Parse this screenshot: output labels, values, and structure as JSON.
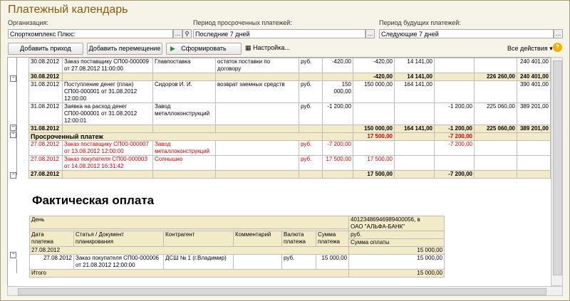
{
  "window": {
    "title": "Платежный календарь"
  },
  "filters": {
    "org_label": "Организация:",
    "org_value": "Спорткомплекс Плюс:",
    "overdue_label": "Период просроченных платежей:",
    "overdue_value": "Последние 7 дней",
    "future_label": "Период будущих платежей:",
    "future_value": "Следующие 7 дней"
  },
  "toolbar": {
    "add_income": "Добавить приход",
    "add_move": "Добавить перемещение",
    "generate": "Сформировать",
    "settings": "Настройка...",
    "all_actions": "Все действия ▾",
    "help": "?"
  },
  "plan_table": {
    "rows": [
      {
        "date": "30.08.2012",
        "doc": "Заказ поставщику СП00-000009\nот 27.08.2012 11:00:00",
        "counterparty": "Главпоставка",
        "comment": "остаток поставки по\nдоговору",
        "cur": "руб.",
        "sum": "-420,00",
        "c1": "-420,00",
        "c2": "14 141,00",
        "c3": "",
        "c4": "",
        "c5": "240 401,00",
        "type": "row"
      },
      {
        "date": "30.08.2012",
        "doc": "",
        "counterparty": "",
        "comment": "",
        "cur": "",
        "sum": "",
        "c1": "-420,00",
        "c2": "14 141,00",
        "c3": "",
        "c4": "226 260,00",
        "c5": "240 401,00",
        "type": "sum"
      },
      {
        "date": "31.08.2012",
        "doc": "Поступление денег (план)\nСП00-000001 от 31.08.2012\n12:00:00",
        "counterparty": "Сидоров И. И.",
        "comment": "возврат заемных средств",
        "cur": "руб.",
        "sum": "150 000,00",
        "c1": "150 000,00",
        "c2": "164 141,00",
        "c3": "",
        "c4": "",
        "c5": "390 401,00",
        "type": "row"
      },
      {
        "date": "31.08.2012",
        "doc": "Заявка на расход денег\nСП00-000001 от 31.08.2012\n12:00:01",
        "counterparty": "Завод\nметаллоконструкций",
        "comment": "",
        "cur": "руб.",
        "sum": "-1 200,00",
        "c1": "",
        "c2": "",
        "c3": "-1 200,00",
        "c4": "225 060,00",
        "c5": "389 201,00",
        "type": "row"
      },
      {
        "date": "31.08.2012",
        "doc": "",
        "counterparty": "",
        "comment": "",
        "cur": "",
        "sum": "",
        "c1": "150 000,00",
        "c2": "164 141,00",
        "c3": "-1 200,00",
        "c4": "225 060,00",
        "c5": "389 201,00",
        "type": "sum"
      },
      {
        "date": "Просроченный платеж",
        "doc": "",
        "counterparty": "",
        "comment": "",
        "cur": "",
        "sum": "",
        "c1": "17 500,00",
        "c2": "",
        "c3": "-7 200,00",
        "c4": "",
        "c5": "",
        "type": "overdue"
      },
      {
        "date": "27.08.2012",
        "doc": "Заказ поставщику СП00-000007\nот 13.08.2012 12:00:00",
        "counterparty": "Завод\nметаллоконструкций",
        "comment": "",
        "cur": "руб.",
        "sum": "-7 200,00",
        "c1": "",
        "c2": "",
        "c3": "-7 200,00",
        "c4": "",
        "c5": "",
        "type": "redrow"
      },
      {
        "date": "27.08.2012",
        "doc": "Заказ покупателя СП00-000003\nот 14.08.2012 16:31:42",
        "counterparty": "Солнышко",
        "comment": "",
        "cur": "руб.",
        "sum": "17 500,00",
        "c1": "17 500,00",
        "c2": "",
        "c3": "",
        "c4": "",
        "c5": "",
        "type": "redrow"
      },
      {
        "date": "27.08.2012",
        "doc": "",
        "counterparty": "",
        "comment": "",
        "cur": "",
        "sum": "",
        "c1": "17 500,00",
        "c2": "",
        "c3": "-7 200,00",
        "c4": "",
        "c5": "",
        "type": "sum"
      }
    ]
  },
  "fact": {
    "heading": "Фактическая оплата",
    "day_label": "День",
    "account": "40123486946989400056, в\nОАО \"АЛЬФА-БАНК\"",
    "col_date": "Дата\nплатежа",
    "col_doc": "Статья / Документ\nпланирования",
    "col_cp": "Контрагент",
    "col_comment": "Комментарий",
    "col_cur": "Валюта\nплатежа",
    "col_sum": "Сумма\nплатежа",
    "cur_label": "руб.",
    "sum_label": "Сумма оплаты",
    "group_date": "27.08.2012",
    "group_sum": "15 000,00",
    "row_date": "27.08.2012",
    "row_doc": "Заказ покупателя СП00-000006\nот 21.08.2012 12:00:00",
    "row_cp": "ДСШ № 1 (г.Владимир)",
    "row_cur": "руб.",
    "row_sum": "15 000,00",
    "row_total": "15 000,00",
    "total_label": "Итого",
    "total_sum": "15 000,00"
  }
}
